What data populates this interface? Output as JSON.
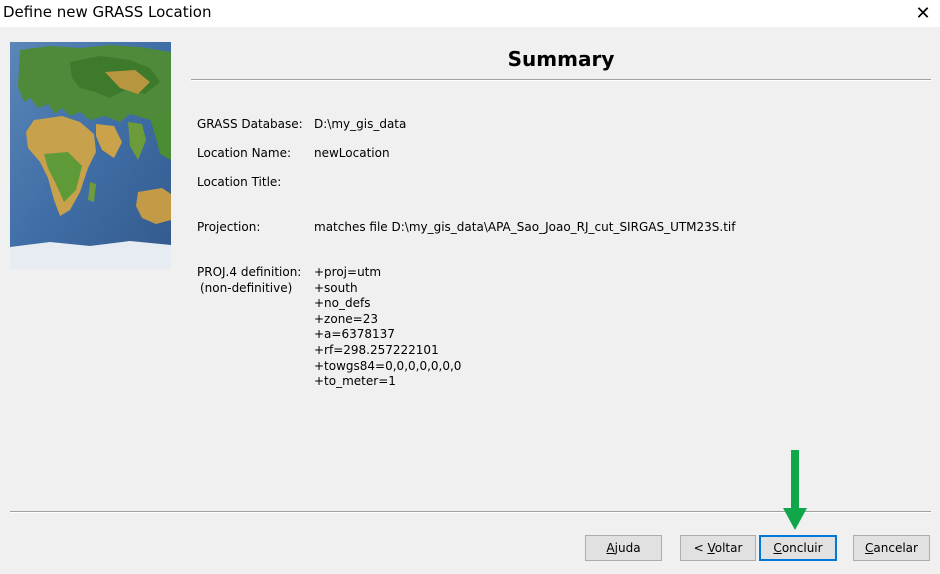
{
  "window": {
    "title": "Define new GRASS Location",
    "close_glyph": "✕"
  },
  "page": {
    "heading": "Summary"
  },
  "summary": {
    "database_label": "GRASS Database:",
    "database_value": "D:\\my_gis_data",
    "location_label": "Location Name:",
    "location_value": "newLocation",
    "title_label": "Location Title:",
    "title_value": "",
    "projection_label": "Projection:",
    "projection_value": "matches file D:\\my_gis_data\\APA_Sao_Joao_RJ_cut_SIRGAS_UTM23S.tif",
    "proj4_label_1": "PROJ.4 definition:",
    "proj4_label_2": "(non-definitive)",
    "proj4_lines": [
      "+proj=utm",
      "+south",
      "+no_defs",
      "+zone=23",
      "+a=6378137",
      "+rf=298.257222101",
      "+towgs84=0,0,0,0,0,0,0",
      "+to_meter=1"
    ]
  },
  "buttons": {
    "help": {
      "pre": "",
      "key": "A",
      "post": "juda"
    },
    "back": {
      "pre": "< ",
      "key": "V",
      "post": "oltar"
    },
    "finish": {
      "pre": "",
      "key": "C",
      "post": "oncluir"
    },
    "cancel": {
      "pre": "",
      "key": "C",
      "post": "ancelar"
    }
  },
  "colors": {
    "accent_border": "#0078d7",
    "arrow": "#10a64a",
    "dialog_bg": "#f0f0f0"
  },
  "icons": {
    "close": "close-icon",
    "annotation": "green-down-arrow-icon",
    "map": "world-map-image"
  }
}
